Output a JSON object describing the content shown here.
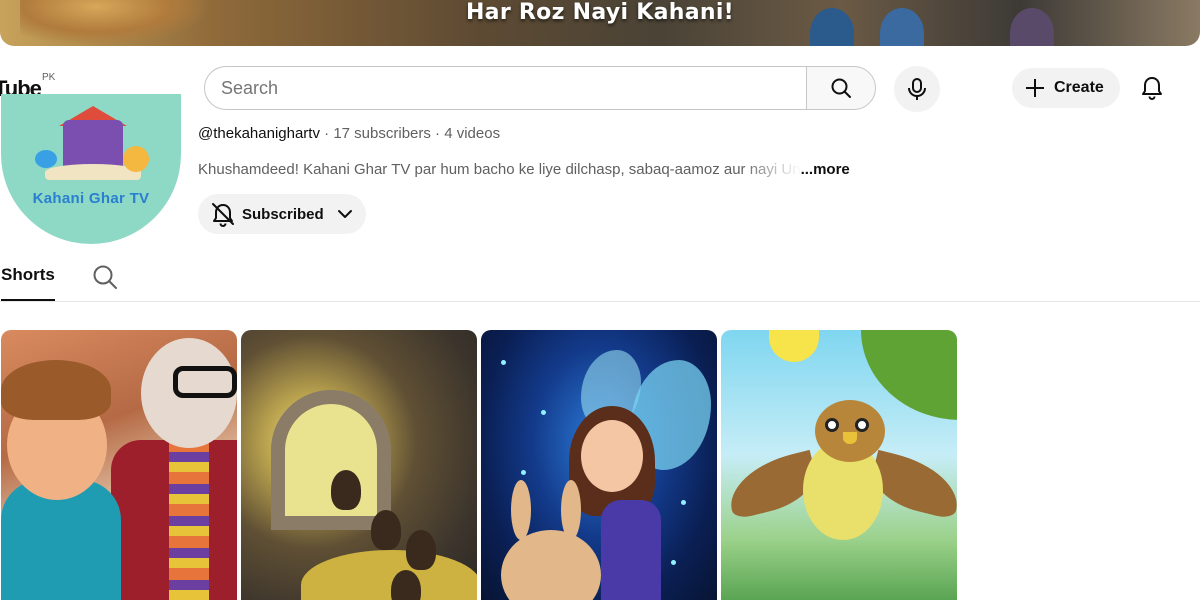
{
  "banner": {
    "title": "Har Roz Nayi Kahani!"
  },
  "header": {
    "logo_text": "Tube",
    "country_code": "PK",
    "search": {
      "placeholder": "Search",
      "value": ""
    },
    "create_label": "Create",
    "icons": {
      "search": "search-icon",
      "mic": "mic-icon",
      "create": "plus-icon",
      "notifications": "bell-icon"
    }
  },
  "channel": {
    "avatar_text": "Kahani Ghar TV",
    "handle": "@thekahanighartv",
    "subscribers": "17 subscribers",
    "videos": "4 videos",
    "separator": "·",
    "description": "Khushamdeed! Kahani Ghar TV par hum bacho ke liye dilchasp, sabaq-aamoz aur nayi Un",
    "more_label": "...more",
    "subscribed_label": "Subscribed"
  },
  "tabs": [
    {
      "label": "Shorts",
      "active": true
    }
  ],
  "shorts": [
    {
      "scene": "boy-and-grandmother"
    },
    {
      "scene": "cave-treasure"
    },
    {
      "scene": "fairy-and-bunny"
    },
    {
      "scene": "flying-owl"
    }
  ],
  "colors": {
    "accent_text": "#0f0f0f",
    "secondary_text": "#606060",
    "chip_background": "#f2f2f2",
    "divider": "#e5e5e5"
  }
}
